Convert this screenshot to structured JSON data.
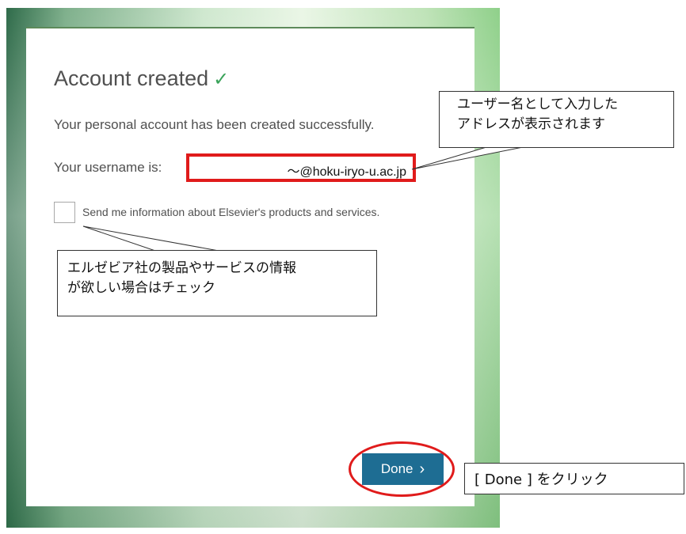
{
  "dialog": {
    "title": "Account created",
    "title_icon": "check-icon",
    "message": "Your personal account has been created successfully.",
    "username_label": "Your username is:",
    "username_value": "～@hoku-iryo-u.ac.jp",
    "newsletter_checked": false,
    "newsletter_label": "Send me information about Elsevier's products and services.",
    "done_label": "Done",
    "done_icon": "chevron-right-icon"
  },
  "annotations": {
    "username_note_line1": "ユーザー名として入力した",
    "username_note_line2": "アドレスが表示されます",
    "newsletter_note_line1": "エルゼビア社の製品やサービスの情報",
    "newsletter_note_line2": "が欲しい場合はチェック",
    "done_note": "[ Done ] をクリック"
  },
  "colors": {
    "highlight": "#e01b1b",
    "button": "#1e6d93",
    "check": "#3aa35a"
  }
}
